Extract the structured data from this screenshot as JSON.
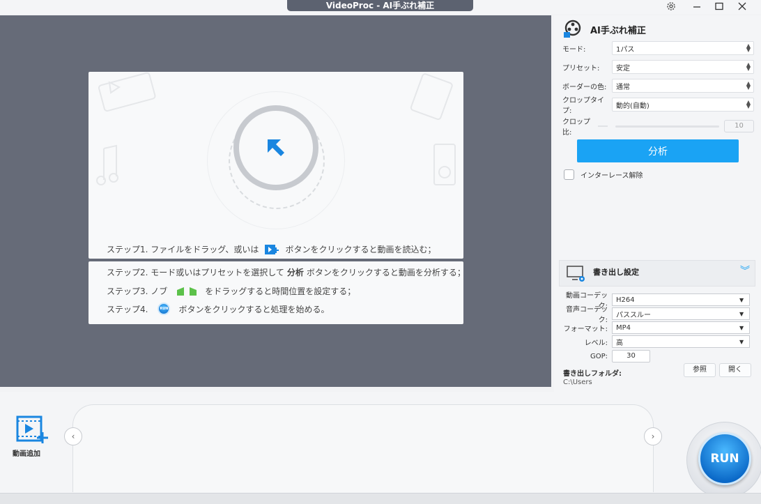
{
  "window": {
    "title": "VideoProc - AI手ぶれ補正"
  },
  "preview": {
    "step1_pre": "ステップ1. ファイルをドラッグ、或いは",
    "step1_post": "ボタンをクリックすると動画を読込む；",
    "step2_pre": "ステップ2. モード或いはプリセットを選択して",
    "step2_bold": "分析",
    "step2_post": "ボタンをクリックすると動画を分析する；",
    "step3_pre": "ステップ3. ノブ",
    "step3_post": "をドラッグすると時間位置を設定する；",
    "step4_pre": "ステップ4.",
    "step4_post": "ボタンをクリックすると処理を始める。",
    "run_small": "RUN"
  },
  "panel": {
    "title": "AI手ぶれ補正",
    "mode_label": "モード:",
    "mode_value": "1パス",
    "preset_label": "プリセット:",
    "preset_value": "安定",
    "border_label": "ボーダーの色:",
    "border_value": "通常",
    "crop_type_label": "クロップタイプ:",
    "crop_type_value": "動的(自動)",
    "crop_ratio_label": "クロップ比:",
    "crop_ratio_value": "10",
    "analyze_label": "分析",
    "deinterlace_label": "インターレース解除"
  },
  "export": {
    "title": "書き出し設定",
    "video_codec_label": "動画コーデック:",
    "video_codec_value": "H264",
    "audio_codec_label": "音声コーデック:",
    "audio_codec_value": "パススルー",
    "format_label": "フォーマット:",
    "format_value": "MP4",
    "level_label": "レベル:",
    "level_value": "高",
    "gop_label": "GOP:",
    "gop_value": "30",
    "folder_label": "書き出しフォルダ:",
    "folder_path": "C:\\Users",
    "browse_label": "参照",
    "open_label": "開く"
  },
  "bottom": {
    "add_video_label": "動画追加",
    "run_label": "RUN"
  },
  "colors": {
    "accent": "#1aa3f4",
    "preview_bg": "#666b78",
    "knob_green": "#5cc14a"
  },
  "icons": [
    "gear-icon",
    "minimize-icon",
    "maximize-icon",
    "close-icon",
    "stabilize-icon",
    "arrow-icon",
    "add-video-icon",
    "chevron-down-icon",
    "prev-icon",
    "next-icon",
    "export-settings-icon"
  ]
}
